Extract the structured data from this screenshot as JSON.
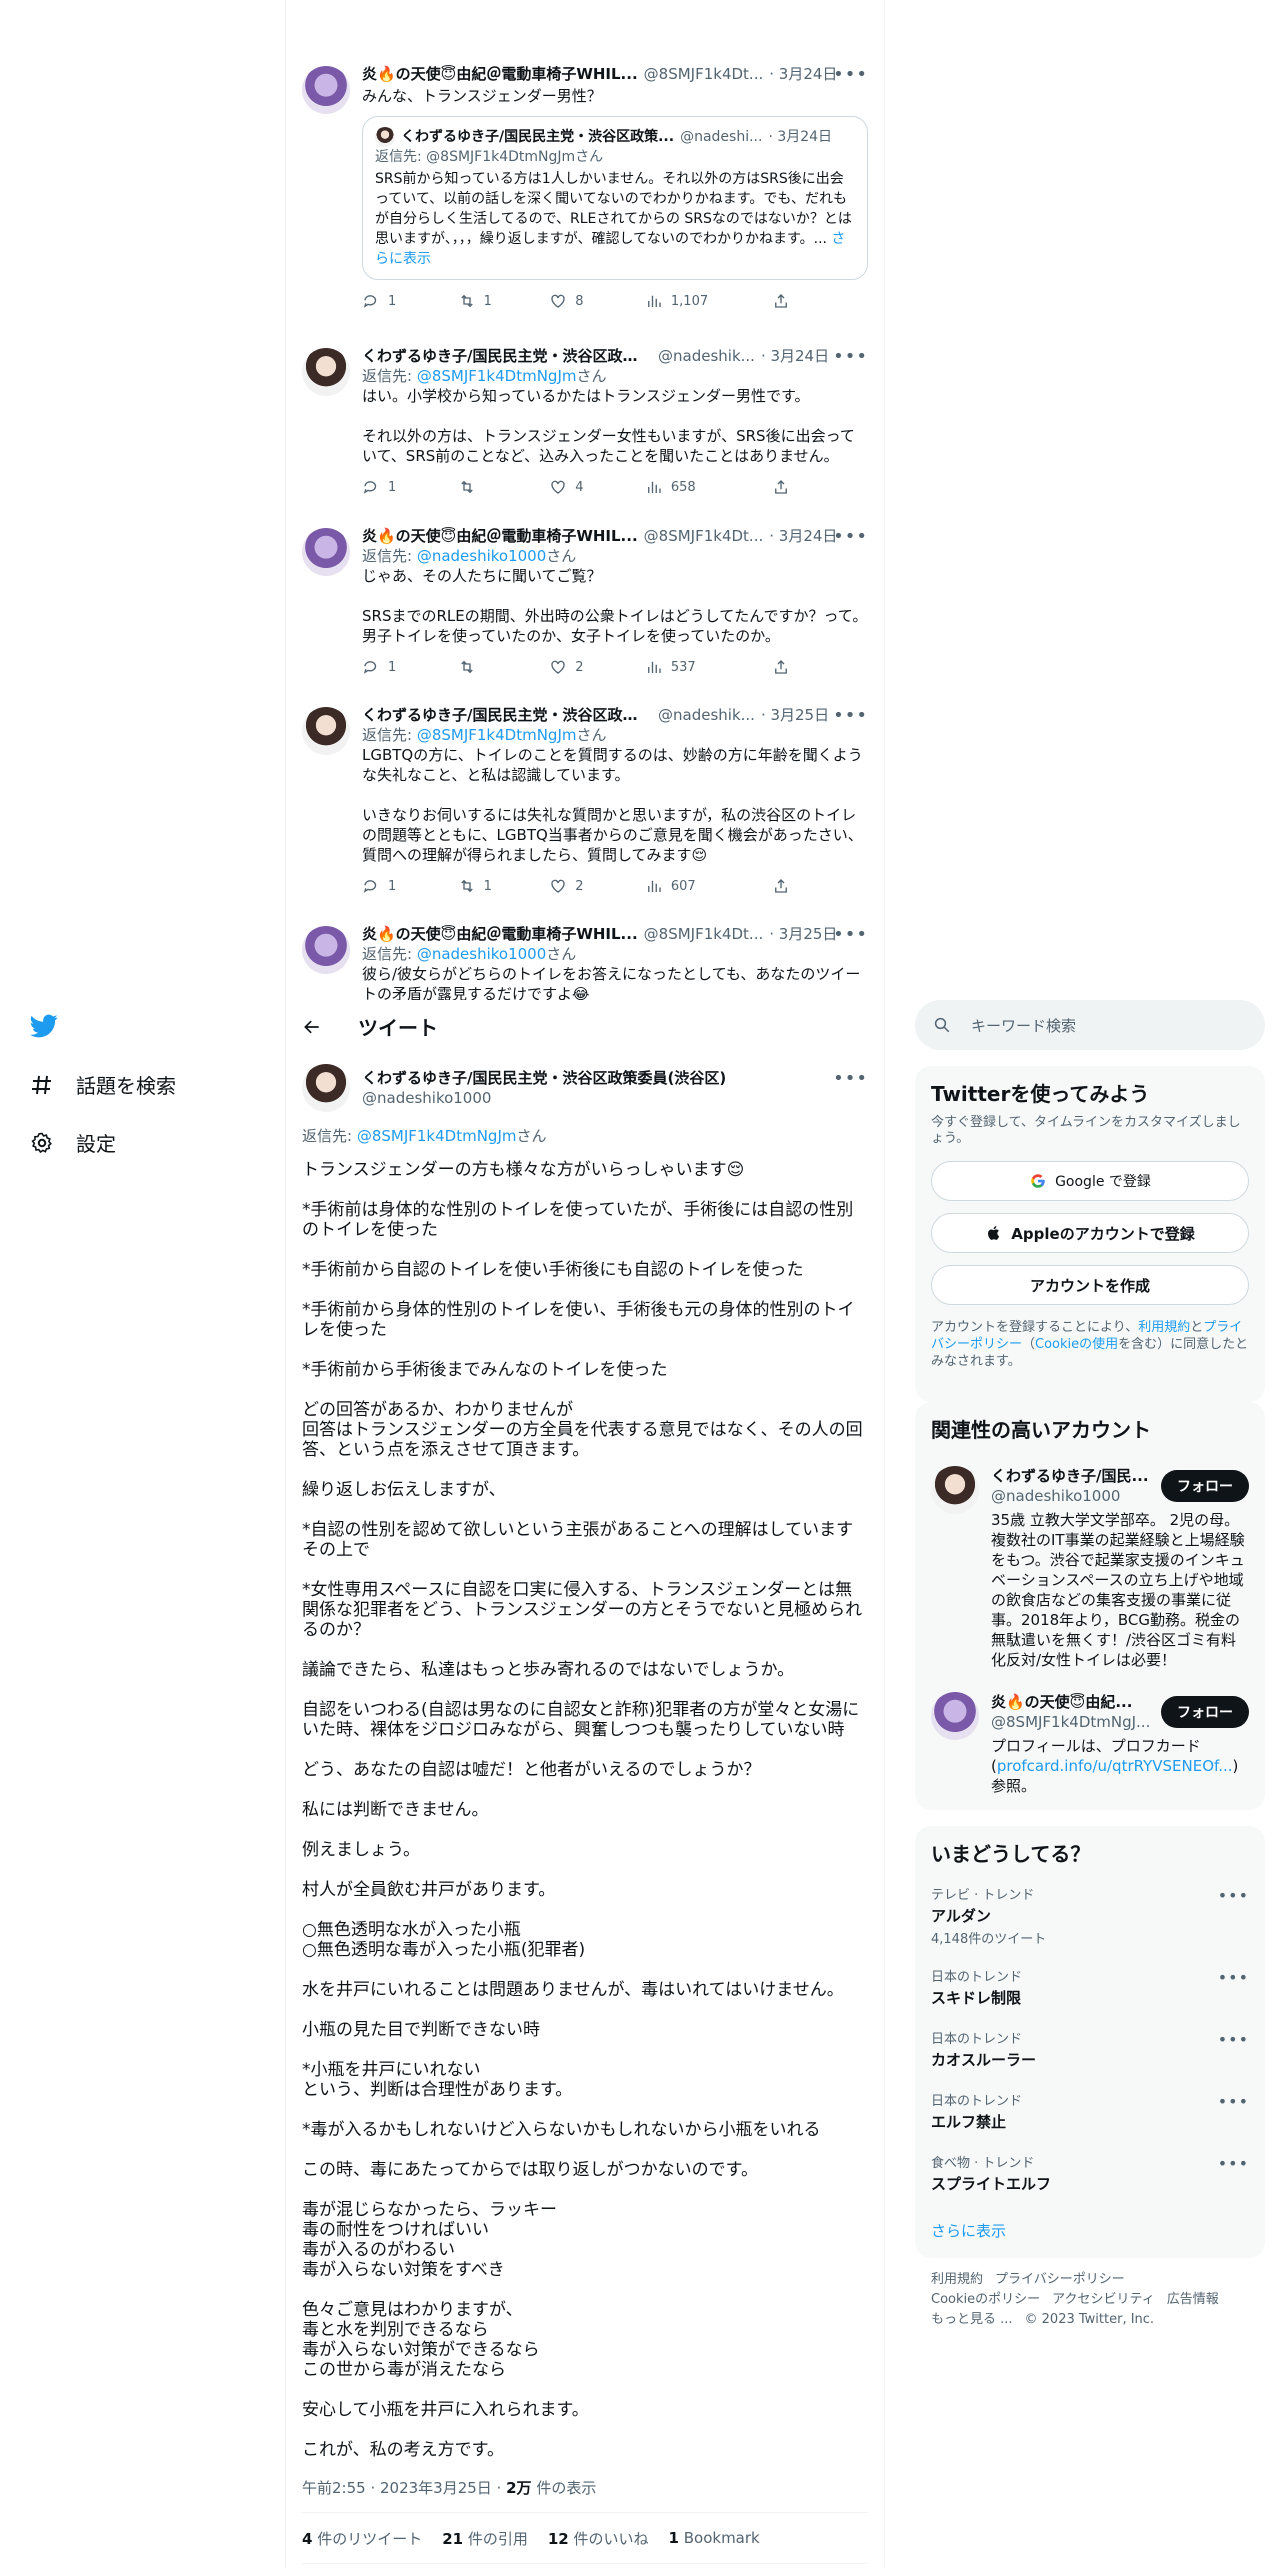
{
  "nav": {
    "explore": "話題を検索",
    "settings": "設定"
  },
  "thread": [
    {
      "name": "炎🔥の天使😇由紀＠電動車椅子WHIL...",
      "handle": "@8SMJF1k4Dt...",
      "date": "· 3月24日",
      "text": "みんな、トランスジェンダー男性？",
      "quote": {
        "name": "くわずるゆき子/国民民主党・渋谷区政策...",
        "handle": "@nadeshi...",
        "date": "· 3月24日",
        "reply_prefix": "返信先: ",
        "reply_handle": "@8SMJF1k4DtmNgJm",
        "reply_suffix": "さん",
        "text": "SRS前から知っている方は1人しかいません。それ以外の方はSRS後に出会っていて、以前の話しを深く聞いてないのでわかりかねます。でも、だれもが自分らしく生活してるので、RLEされてからの SRSなのではないか？とは思いますが、，，，繰り返しますが、確認してないのでわかりかねます。...",
        "more": "さらに表示"
      },
      "replies": "1",
      "retweets": "1",
      "likes": "8",
      "views": "1,107"
    },
    {
      "name": "くわずるゆき子/国民民主党・渋谷区政策委...",
      "handle": "@nadeshik...",
      "date": "· 3月24日",
      "reply_prefix": "返信先: ",
      "reply_handle": "@8SMJF1k4DtmNgJm",
      "reply_suffix": "さん",
      "text": "はい。小学校から知っているかたはトランスジェンダー男性です。\n\nそれ以外の方は、トランスジェンダー女性もいますが、SRS後に出会っていて、SRS前のことなど、込み入ったことを聞いたことはありません。",
      "replies": "1",
      "retweets": "",
      "likes": "4",
      "views": "658"
    },
    {
      "name": "炎🔥の天使😇由紀＠電動車椅子WHIL...",
      "handle": "@8SMJF1k4Dt...",
      "date": "· 3月24日",
      "reply_prefix": "返信先: ",
      "reply_handle": "@nadeshiko1000",
      "reply_suffix": "さん",
      "text": "じゃあ、その人たちに聞いてご覧？\n\nSRSまでのRLEの期間、外出時の公衆トイレはどうしてたんですか？って。男子トイレを使っていたのか、女子トイレを使っていたのか。",
      "replies": "1",
      "retweets": "",
      "likes": "2",
      "views": "537"
    },
    {
      "name": "くわずるゆき子/国民民主党・渋谷区政策委...",
      "handle": "@nadeshik...",
      "date": "· 3月25日",
      "reply_prefix": "返信先: ",
      "reply_handle": "@8SMJF1k4DtmNgJm",
      "reply_suffix": "さん",
      "text": "LGBTQの方に、トイレのことを質問するのは、妙齢の方に年齢を聞くような失礼なこと、と私は認識しています。\n\nいきなりお伺いするには失礼な質問かと思いますが，私の渋谷区のトイレの問題等とともに、LGBTQ当事者からのご意見を聞く機会があったさい、質問への理解が得られましたら、質問してみます😌",
      "replies": "1",
      "retweets": "1",
      "likes": "2",
      "views": "607"
    },
    {
      "name": "炎🔥の天使😇由紀＠電動車椅子WHIL...",
      "handle": "@8SMJF1k4Dt...",
      "date": "· 3月25日",
      "reply_prefix": "返信先: ",
      "reply_handle": "@nadeshiko1000",
      "reply_suffix": "さん",
      "text": "彼ら/彼女らがどちらのトイレをお答えになったとしても、あなたのツイートの矛盾が露見するだけですよ😂"
    }
  ],
  "main": {
    "header": "ツイート",
    "name": "くわずるゆき子/国民民主党・渋谷区政策委員(渋谷区)",
    "handle": "@nadeshiko1000",
    "reply_prefix": "返信先: ",
    "reply_handle": "@8SMJF1k4DtmNgJm",
    "reply_suffix": "さん",
    "text": "トランスジェンダーの方も様々な方がいらっしゃいます😌\n\n*手術前は身体的な性別のトイレを使っていたが、手術後には自認の性別のトイレを使った\n\n*手術前から自認のトイレを使い手術後にも自認のトイレを使った\n\n*手術前から身体的性別のトイレを使い、手術後も元の身体的性別のトイレを使った\n\n*手術前から手術後までみんなのトイレを使った\n\nどの回答があるか、わかりませんが\n回答はトランスジェンダーの方全員を代表する意見ではなく、その人の回答、という点を添えさせて頂きます。\n\n繰り返しお伝えしますが、\n\n*自認の性別を認めて欲しいという主張があることへの理解はしています\nその上で\n\n*女性専用スペースに自認を口実に侵入する、トランスジェンダーとは無関係な犯罪者をどう、トランスジェンダーの方とそうでないと見極められるのか？\n\n議論できたら、私達はもっと歩み寄れるのではないでしょうか。\n\n自認をいつわる(自認は男なのに自認女と詐称)犯罪者の方が堂々と女湯にいた時、裸体をジロジロみながら、興奮しつつも襲ったりしていない時\n\nどう、あなたの自認は嘘だ！と他者がいえるのでしょうか？\n\n私には判断できません。\n\n例えましょう。\n\n村人が全員飲む井戸があります。\n\n○無色透明な水が入った小瓶\n○無色透明な毒が入った小瓶(犯罪者)\n\n水を井戸にいれることは問題ありませんが、毒はいれてはいけません。\n\n小瓶の見た目で判断できない時\n\n*小瓶を井戸にいれない\nという、判断は合理性があります。\n\n*毒が入るかもしれないけど入らないかもしれないから小瓶をいれる\n\nこの時、毒にあたってからでは取り返しがつかないのです。\n\n毒が混じらなかったら、ラッキー\n毒の耐性をつければいい\n毒が入るのがわるい\n毒が入らない対策をすべき\n\n色々ご意見はわかりますが、\n毒と水を判別できるなら\n毒が入らない対策ができるなら\nこの世から毒が消えたなら\n\n安心して小瓶を井戸に入れられます。\n\nこれが、私の考え方です。",
    "time": "午前2:55 · 2023年3月25日 · ",
    "views_num": "2万",
    "views_label": " 件の表示",
    "stats": [
      {
        "num": "4",
        "label": " 件のリツイート"
      },
      {
        "num": "21",
        "label": " 件の引用"
      },
      {
        "num": "12",
        "label": " 件のいいね"
      },
      {
        "num": "1",
        "label": " Bookmark"
      }
    ]
  },
  "right": {
    "search_placeholder": "キーワード検索",
    "signup": {
      "title": "Twitterを使ってみよう",
      "subtitle": "今すぐ登録して、タイムラインをカスタマイズしましょう。",
      "google": "Google で登録",
      "apple": "Appleのアカウントで登録",
      "create": "アカウントを作成",
      "legal_pre": "アカウントを登録することにより、",
      "legal_link1": "利用規約",
      "legal_and": "と",
      "legal_link2": "プライバシーポリシー",
      "legal_paren": "（",
      "legal_link3": "Cookieの使用",
      "legal_post": "を含む）に同意したとみなされます。"
    },
    "relevant": {
      "title": "関連性の高いアカウント",
      "follow": "フォロー",
      "accounts": [
        {
          "name": "くわずるゆき子/国民...",
          "handle": "@nadeshiko1000",
          "bio": "35歳 立教大学文学部卒。 2児の母。複数社のIT事業の起業経験と上場経験をもつ。渋谷で起業家支援のインキュベーションスペースの立ち上げや地域の飲食店などの集客支援の事業に従事。2018年より，BCG勤務。税金の無駄遣いを無くす！/渋谷区ゴミ有料化反対/女性トイレは必要！"
        },
        {
          "name": "炎🔥の天使😇由紀...",
          "handle": "@8SMJF1k4DtmNgJ...",
          "bio_pre": "プロフィールは、プロフカード(",
          "bio_link": "profcard.info/u/qtrRYVSENEOf...",
          "bio_post": ")参照。"
        }
      ]
    },
    "trends": {
      "title": "いまどうしてる？",
      "items": [
        {
          "category": "テレビ · トレンド",
          "name": "アルダン",
          "count": "4,148件のツイート"
        },
        {
          "category": "日本のトレンド",
          "name": "スキドレ制限",
          "count": ""
        },
        {
          "category": "日本のトレンド",
          "name": "カオスルーラー",
          "count": ""
        },
        {
          "category": "日本のトレンド",
          "name": "エルフ禁止",
          "count": ""
        },
        {
          "category": "食べ物 · トレンド",
          "name": "スプライトエルフ",
          "count": ""
        }
      ],
      "show_more": "さらに表示"
    },
    "footer": {
      "links": [
        "利用規約",
        "プライバシーポリシー",
        "Cookieのポリシー",
        "アクセシビリティ",
        "広告情報",
        "もっと見る ..."
      ],
      "copyright": "© 2023 Twitter, Inc."
    }
  },
  "colors": {
    "accent": "#1d9bf0",
    "text": "#0f1419",
    "muted": "#536471"
  }
}
